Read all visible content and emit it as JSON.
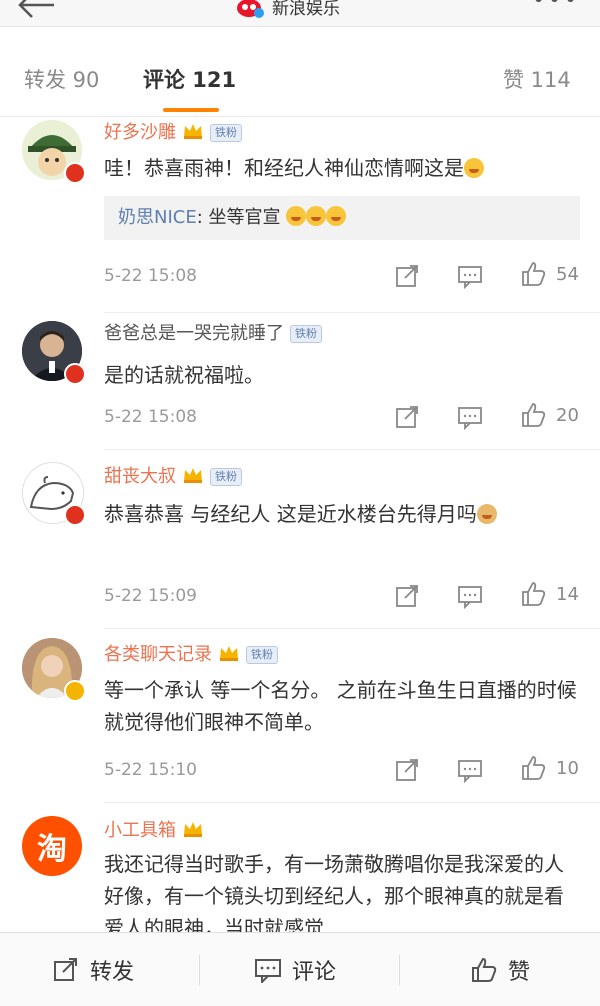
{
  "header": {
    "title": "新浪娱乐"
  },
  "tabs": [
    {
      "label": "转发 90"
    },
    {
      "label": "评论 121"
    },
    {
      "label": "赞 114"
    }
  ],
  "comments": [
    {
      "user": "好多沙雕",
      "fan_badge": "铁粉",
      "text": "哇！恭喜雨神！和经纪人神仙恋情啊这是",
      "reply_user": "奶思NICE",
      "reply_text": ": 坐等官宣",
      "time": "5-22 15:08",
      "likes": "54"
    },
    {
      "user": "爸爸总是一哭完就睡了",
      "fan_badge": "铁粉",
      "text": "是的话就祝福啦。",
      "time": "5-22 15:08",
      "likes": "20"
    },
    {
      "user": "甜丧大叔",
      "fan_badge": "铁粉",
      "text": "恭喜恭喜 与经纪人 这是近水楼台先得月吗",
      "time": "5-22 15:09",
      "likes": "14"
    },
    {
      "user": "各类聊天记录",
      "fan_badge": "铁粉",
      "text": "等一个承认 等一个名分。 之前在斗鱼生日直播的时候 就觉得他们眼神不简单。",
      "time": "5-22 15:10",
      "likes": "10"
    },
    {
      "user": "小工具箱",
      "avatar_text": "淘",
      "text": "我还记得当时歌手，有一场萧敬腾唱你是我深爱的人好像，有一个镜头切到经纪人，那个眼神真的就是看爱人的眼神，当时就感觉"
    }
  ],
  "bottom": {
    "repost": "转发",
    "comment": "评论",
    "like": "赞"
  },
  "colors": {
    "accent": "#ff8200",
    "username": "#eb7350",
    "link": "#5f7fb0"
  }
}
